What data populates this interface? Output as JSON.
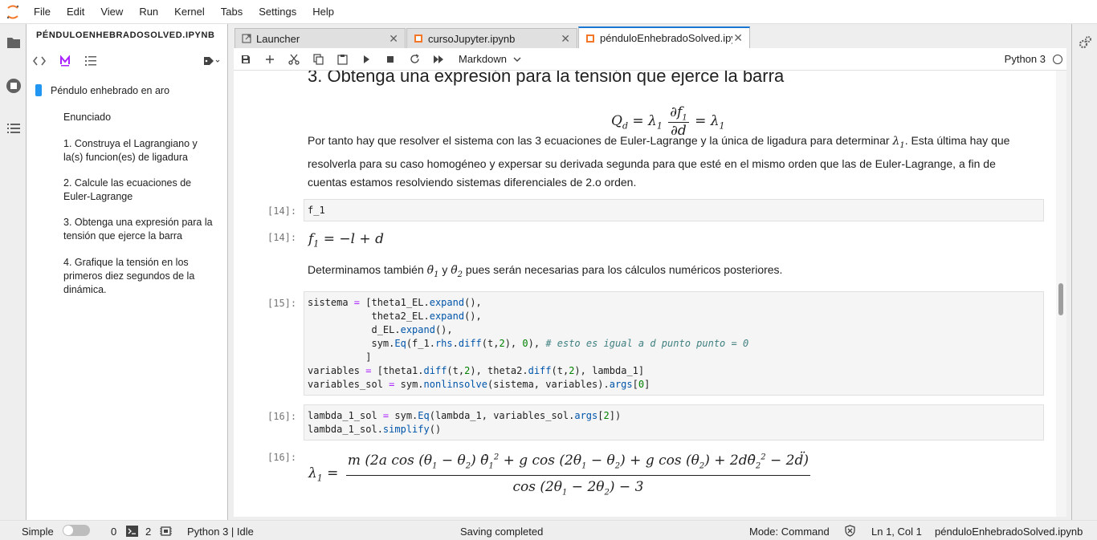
{
  "menu": {
    "items": [
      "File",
      "Edit",
      "View",
      "Run",
      "Kernel",
      "Tabs",
      "Settings",
      "Help"
    ]
  },
  "toc": {
    "title": "PÉNDULOENHEBRADOSOLVED.IPYNB",
    "items": [
      "Péndulo enhebrado en aro",
      "Enunciado",
      "1. Construya el Lagrangiano y la(s) funcion(es) de ligadura",
      "2. Calcule las ecuaciones de Euler-Lagrange",
      "3. Obtenga una expresión para la tensión que ejerce la barra",
      "4. Grafique la tensión en los primeros diez segundos de la dinámica."
    ]
  },
  "tabs": [
    {
      "label": "Launcher",
      "icon": "launcher-icon"
    },
    {
      "label": "cursoJupyter.ipynb",
      "icon": "notebook-icon"
    },
    {
      "label": "pénduloEnhebradoSolved.ipynb",
      "icon": "notebook-icon"
    }
  ],
  "toolbar": {
    "cell_type": "Markdown",
    "kernel": "Python 3"
  },
  "notebook": {
    "heading": "3. Obtenga una expresión para la tensión que ejerce la barra",
    "para1_a": "Por tanto hay que resolver el sistema con las 3 ecuaciones de Euler-Lagrange y la única de ligadura para determinar",
    "para1_b": ". Esta última hay que resolverla para su caso homogéneo y expersar su derivada segunda para que esté en el mismo orden que las de Euler-Lagrange, a fin de cuentas estamos resolviendo sistemas diferenciales de 2.o orden.",
    "prompt14_in": "[14]:",
    "prompt14_out": "[14]:",
    "code14": "f_1",
    "para2_a": "Determinamos también",
    "para2_y": "y",
    "para2_b": "pues serán necesarias para los cálculos numéricos posteriores.",
    "prompt15_in": "[15]:",
    "prompt16_in": "[16]:",
    "prompt16_out": "[16]:"
  },
  "statusbar": {
    "mode_label": "Simple",
    "terminals": "0",
    "kernels": "2",
    "kernel_status": "Python 3 | Idle",
    "message": "Saving completed",
    "command_mode": "Mode: Command",
    "cursor": "Ln 1, Col 1",
    "filename": "pénduloEnhebradoSolved.ipynb"
  }
}
